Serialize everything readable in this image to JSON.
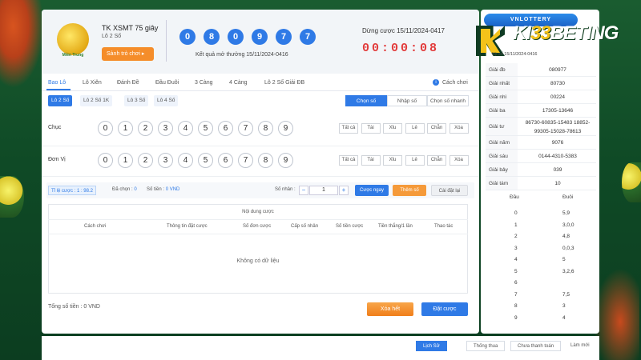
{
  "header": {
    "title": "TK XSMT 75 giây",
    "subtitle": "Lô 2 Số",
    "logo_text": "Miền Trung",
    "ghost_button": "Sảnh trò chơi",
    "numbers": [
      "0",
      "8",
      "0",
      "9",
      "7",
      "7"
    ],
    "result_label": "Kết quả mở thưởng 15/11/2024-0416",
    "countdown_label": "Dừng cược 15/11/2024-0417",
    "countdown": "00:00:08"
  },
  "tabs": {
    "active": "Bao Lô",
    "items": [
      "Bao Lô",
      "Lô Xiên",
      "Đánh Đề",
      "Đầu Đuôi",
      "3 Càng",
      "4 Càng",
      "Lô 2 Số Giải ĐB"
    ],
    "rules": "Cách chơi"
  },
  "subtabs": [
    "Lô 2 Số",
    "Lô 2 Số 1K",
    "Lô 3 Số",
    "Lô 4 Số"
  ],
  "modes": [
    "Chọn số",
    "Nhập số",
    "Chọn số nhanh"
  ],
  "rows": [
    {
      "label": "Chục"
    },
    {
      "label": "Đơn Vị"
    }
  ],
  "digits": [
    "0",
    "1",
    "2",
    "3",
    "4",
    "5",
    "6",
    "7",
    "8",
    "9"
  ],
  "quick": [
    "Tất cả",
    "Tài",
    "Xỉu",
    "Lẻ",
    "Chẵn",
    "Xóa"
  ],
  "bet_bar": {
    "odds": "Tỉ lệ cược : 1 : 98.2",
    "selected_label": "Đã chọn :",
    "selected_value": "0",
    "amount_label": "Số tiền :",
    "amount_value": "0 VND",
    "multiplier_label": "Số nhân :",
    "multiplier": "1",
    "minus": "−",
    "plus": "+",
    "quick_bet": "Cược ngay",
    "add": "Thêm số",
    "reset": "Cài đặt lại"
  },
  "table": {
    "title": "Nội dung cược",
    "columns": [
      "Cách chơi",
      "Thông tin đặt cược",
      "Số đơn cược",
      "Cấp số nhân",
      "Số tiền cược",
      "Tiền thắng/1 lần",
      "Thao tác"
    ],
    "empty": "Không có dữ liệu"
  },
  "footer": {
    "total_label": "Tổng số tiền :",
    "total_value": "0 VND",
    "clear": "Xóa hết",
    "place": "Đặt cược"
  },
  "brand": {
    "badge": "VNLOTTERY",
    "k_text": "KI",
    "k_text_gold": "33",
    "k_text_rest": "BETING"
  },
  "results_panel": {
    "period": "Kỳ số 15/11/2024-0416",
    "rows": [
      {
        "label": "Giải đb",
        "value": "080977"
      },
      {
        "label": "Giải nhất",
        "value": "80730"
      },
      {
        "label": "Giải nhì",
        "value": "00224"
      },
      {
        "label": "Giải ba",
        "value": "17305-13646"
      },
      {
        "label": "Giải tư",
        "value": "86730-60835-15483 18852-99305-15028-78613"
      },
      {
        "label": "Giải năm",
        "value": "9076"
      },
      {
        "label": "Giải sáu",
        "value": "0144-4310-5383"
      },
      {
        "label": "Giải bảy",
        "value": "039"
      },
      {
        "label": "Giải tám",
        "value": "10"
      }
    ],
    "dd_head": {
      "dau": "Đầu",
      "duoi": "Đuôi"
    },
    "dd": [
      {
        "dau": "0",
        "duoi": "5,9"
      },
      {
        "dau": "1",
        "duoi": "3,0,0"
      },
      {
        "dau": "2",
        "duoi": "4,8"
      },
      {
        "dau": "3",
        "duoi": "0,0,3"
      },
      {
        "dau": "4",
        "duoi": "5"
      },
      {
        "dau": "5",
        "duoi": "3,2,6"
      },
      {
        "dau": "6",
        "duoi": ""
      },
      {
        "dau": "7",
        "duoi": "7,5"
      },
      {
        "dau": "8",
        "duoi": "3"
      },
      {
        "dau": "9",
        "duoi": "4"
      }
    ]
  },
  "bottom_tabs": [
    "Lịch Sử",
    "Thống thua",
    "Chưa thanh toán",
    "Làm mới"
  ],
  "colors": {
    "primary": "#2f7ae6",
    "accent": "#f58d2a",
    "countdown": "#e23b3b",
    "bg": "#1a5c30"
  }
}
